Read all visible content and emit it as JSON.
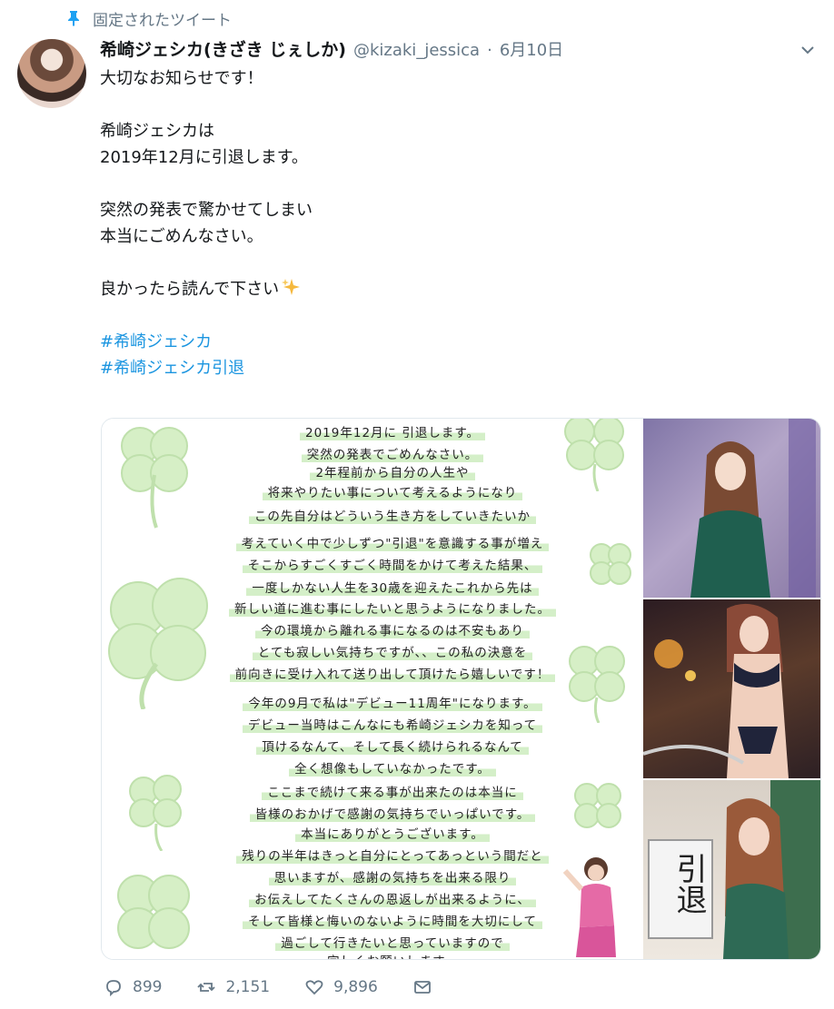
{
  "pinned": {
    "label": "固定されたツイート",
    "icon": "pin-icon"
  },
  "tweet": {
    "author_name": "希崎ジェシカ(きざき じぇしか)",
    "handle": "@kizaki_jessica",
    "separator": "·",
    "date": "6月10日",
    "lines": [
      "大切なお知らせです！",
      "",
      "希崎ジェシカは",
      "2019年12月に引退します。",
      "",
      "突然の発表で驚かせてしまい",
      "本当にごめんなさい。",
      "",
      "良かったら読んで下さい"
    ],
    "hashtags": [
      "#希崎ジェシカ",
      "#希崎ジェシカ引退"
    ]
  },
  "letter": {
    "lines": [
      "2019年12月に 引退します。",
      "突然の発表でごめんなさい。",
      "2年程前から自分の人生や",
      "将来やりたい事について考えるようになり",
      "この先自分はどういう生き方をしていきたいか",
      "考えていく中で少しずつ\"引退\"を意識する事が増え",
      "そこからすごくすごく時間をかけて考えた結果、",
      "一度しかない人生を30歳を迎えたこれから先は",
      "新しい道に進む事にしたいと思うようになりました。",
      "今の環境から離れる事になるのは不安もあり",
      "とても寂しい気持ちですが、、この私の決意を",
      "前向きに受け入れて送り出して頂けたら嬉しいです！",
      "今年の9月で私は\"デビュー11周年\"になります。",
      "デビュー当時はこんなにも希崎ジェシカを知って",
      "頂けるなんて、そして長く続けられるなんて",
      "全く想像もしていなかったです。",
      "ここまで続けて来る事が出来たのは本当に",
      "皆様のおかげで感謝の気持ちでいっぱいです。",
      "本当にありがとうございます。",
      "残りの半年はきっと自分にとってあっという間だと",
      "思いますが、感謝の気持ちを出来る限り",
      "お伝えしてたくさんの恩返しが出来るように、",
      "そして皆様と悔いのないように時間を大切にして",
      "過ごして行きたいと思っていますので",
      "宜しくお願いします。"
    ]
  },
  "sign": {
    "text": "引退"
  },
  "actions": {
    "reply_count": "899",
    "retweet_count": "2,151",
    "like_count": "9,896"
  },
  "colors": {
    "link": "#1b95e0",
    "muted": "#657786",
    "highlight": "#d4efc8",
    "clover": "#cfeabd"
  }
}
